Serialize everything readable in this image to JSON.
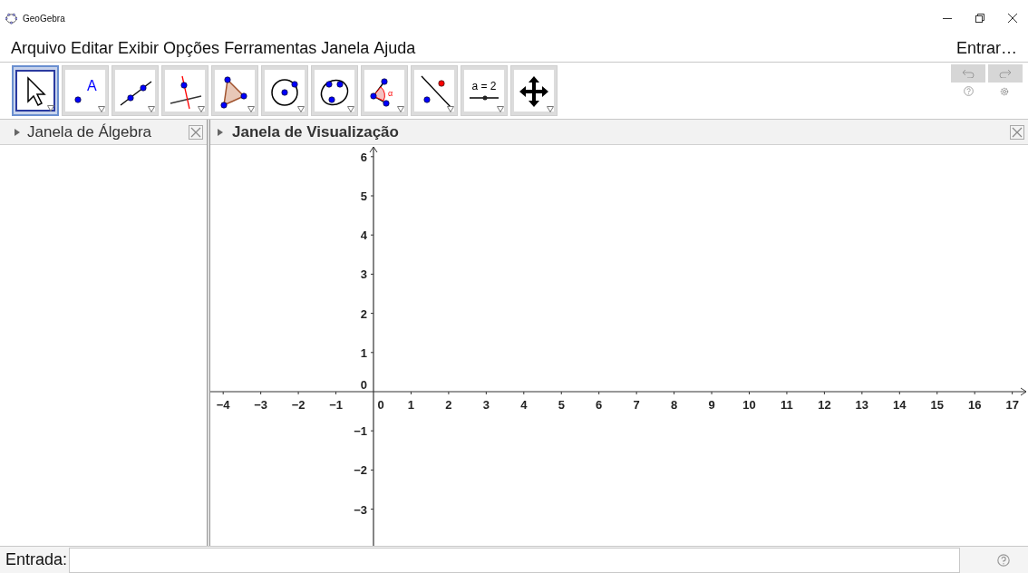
{
  "window": {
    "title": "GeoGebra"
  },
  "menu": {
    "items": [
      "Arquivo",
      "Editar",
      "Exibir",
      "Opções",
      "Ferramentas",
      "Janela",
      "Ajuda"
    ],
    "sign_in": "Entrar…"
  },
  "toolbar": {
    "tools": [
      {
        "kind": "move",
        "selected": true
      },
      {
        "kind": "point",
        "selected": false,
        "label": "A"
      },
      {
        "kind": "line",
        "selected": false
      },
      {
        "kind": "perpendicular",
        "selected": false
      },
      {
        "kind": "polygon",
        "selected": false
      },
      {
        "kind": "circle",
        "selected": false
      },
      {
        "kind": "conic",
        "selected": false
      },
      {
        "kind": "angle",
        "selected": false,
        "label": "α"
      },
      {
        "kind": "reflect",
        "selected": false
      },
      {
        "kind": "slider",
        "selected": false,
        "label": "a = 2"
      },
      {
        "kind": "move_view",
        "selected": false
      }
    ],
    "undo": {
      "disabled": true
    },
    "redo": {
      "disabled": true
    }
  },
  "algebra_panel": {
    "title": "Janela de Álgebra"
  },
  "graphics_panel": {
    "title": "Janela de Visualização",
    "x_labels": [
      "−4",
      "−3",
      "−2",
      "−1",
      "0",
      "1",
      "2",
      "3",
      "4",
      "5",
      "6",
      "7",
      "8",
      "9",
      "10",
      "11",
      "12",
      "13",
      "14",
      "15",
      "16",
      "17"
    ],
    "y_labels": [
      "6",
      "5",
      "4",
      "3",
      "2",
      "1",
      "0",
      "−1",
      "−2",
      "−3"
    ]
  },
  "input_bar": {
    "label": "Entrada:"
  }
}
